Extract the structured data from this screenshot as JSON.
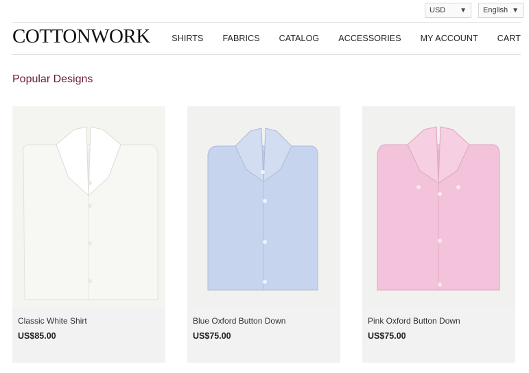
{
  "topbar": {
    "currency": {
      "value": "USD",
      "caret": "▼"
    },
    "language": {
      "value": "English",
      "caret": "▼"
    }
  },
  "header": {
    "logo": "COTTONWORK",
    "nav": [
      "SHIRTS",
      "FABRICS",
      "CATALOG",
      "ACCESSORIES",
      "MY ACCOUNT",
      "CART"
    ]
  },
  "main": {
    "section_title": "Popular Designs",
    "products": [
      {
        "name": "Classic White Shirt",
        "price": "US$85.00",
        "color": "#f7f7f4"
      },
      {
        "name": "Blue Oxford Button Down",
        "price": "US$75.00",
        "color": "#c7d4ee"
      },
      {
        "name": "Pink Oxford Button Down",
        "price": "US$75.00",
        "color": "#f2c3da"
      }
    ]
  },
  "colors": {
    "accent": "#6a1a3c",
    "card_bg": "#f2f2f2"
  }
}
